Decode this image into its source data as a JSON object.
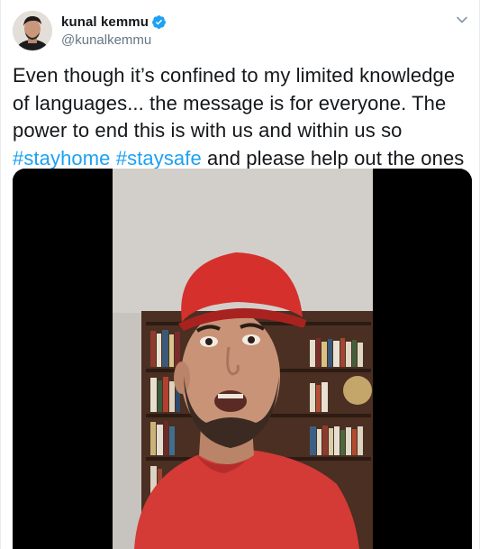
{
  "tweet": {
    "author": {
      "display_name": "kunal kemmu",
      "handle": "@kunalkemmu",
      "verified": true
    },
    "text_parts": {
      "p1": "Even though it’s confined to my limited knowledge of languages... the message is for everyone. The power to end this is with us and within us so ",
      "hashtag1": "#stayhome",
      "space": " ",
      "hashtag2": "#staysafe",
      "p2": " and please help out the ones in need."
    },
    "media": {
      "type": "video"
    }
  },
  "colors": {
    "link": "#1da1f2",
    "secondary_text": "#657786",
    "primary_text": "#14171a",
    "verified_badge": "#1da1f2"
  },
  "icons": {
    "verified": "verified-badge-icon",
    "caret": "chevron-down-icon"
  }
}
